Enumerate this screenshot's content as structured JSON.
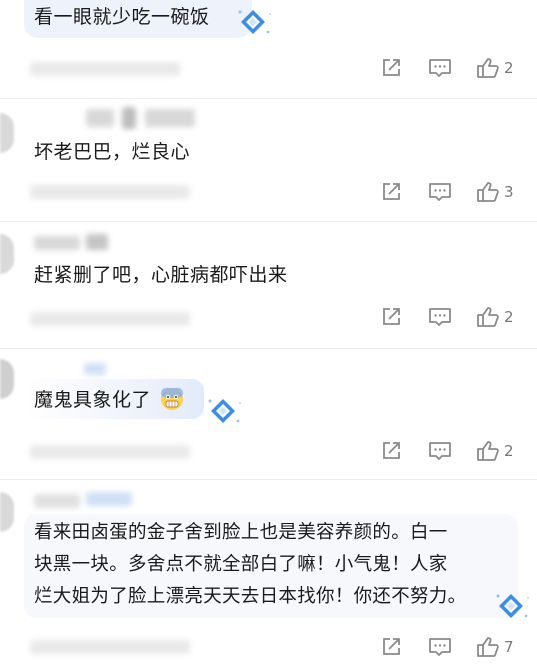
{
  "comments": [
    {
      "text": "看一眼就少吃一碗饭",
      "likes": "2",
      "has_gem": true
    },
    {
      "text": "坏老巴巴，烂良心",
      "likes": "3",
      "has_gem": false
    },
    {
      "text": "赶紧删了吧，心脏病都吓出来",
      "likes": "2",
      "has_gem": false
    },
    {
      "text": "魔鬼具象化了",
      "likes": "2",
      "has_gem": true,
      "emoji": "scared-face-emoji"
    },
    {
      "text": "看来田卤蛋的金子舍到脸上也是美容养颜的。白一\n块黑一块。多舍点不就全部白了嘛！小气鬼！人家\n烂大姐为了脸上漂亮天天去日本找你！你还不努力。",
      "likes": "7",
      "has_gem": true
    }
  ],
  "icons": {
    "share": "share-icon",
    "reply": "comment-icon",
    "like": "thumbs-up-icon",
    "badge": "diamond-badge-icon"
  },
  "colors": {
    "icon_gray": "#8a8a8a",
    "bubble_blue": "#eef2fb",
    "gem_blue": "#3b8ee8"
  }
}
